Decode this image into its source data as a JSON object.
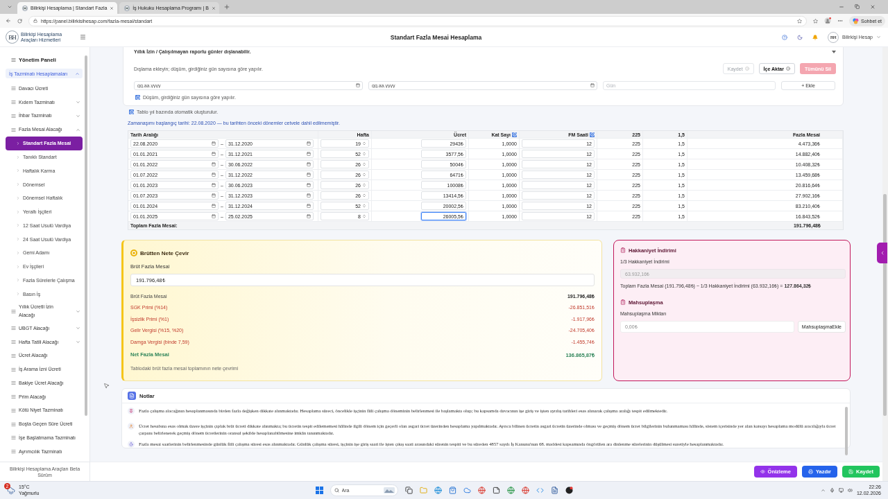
{
  "browser": {
    "tabs": [
      {
        "title": "Bilirkişi Hesaplama | Standart Fazla",
        "selected": true
      },
      {
        "title": "İş Hukuku Hesaplama Programı | B",
        "selected": false
      }
    ],
    "url": "https://panel.bilirkisihesap.com/fazla-mesai/standart",
    "chat_button": "Sohbet et"
  },
  "header": {
    "logo_initials": "BH",
    "logo_text": "Bilirkişi Hesaplama Araçları Hizmetleri",
    "title": "Standart Fazla Mesai Hesaplama",
    "account_initials": "BH",
    "account": "Bilirkişi Hesap"
  },
  "sidebar": {
    "panel_link": "Yönetim Paneli",
    "group": {
      "label": "İş Tazminatı Hesaplamaları",
      "expanded": true,
      "items": [
        {
          "label": "Davacı Ücreti",
          "kind": "link"
        },
        {
          "label": "Kıdem Tazminatı",
          "kind": "menu",
          "expanded": false
        },
        {
          "label": "İhbar Tazminatı",
          "kind": "menu",
          "expanded": false
        },
        {
          "label": "Fazla Mesai Alacağı",
          "kind": "menu",
          "expanded": true,
          "children": [
            {
              "label": "Standart Fazla Mesai",
              "selected": true
            },
            {
              "label": "Tanıklı Standart",
              "selected": false
            },
            {
              "label": "Haftalık Karma",
              "selected": false
            },
            {
              "label": "Dönemsel",
              "selected": false
            },
            {
              "label": "Dönemsel Haftalık",
              "selected": false
            },
            {
              "label": "Yeraltı İşçileri",
              "selected": false
            },
            {
              "label": "12 Saat Usulü Vardiya",
              "selected": false
            },
            {
              "label": "24 Saat Usulü Vardiya",
              "selected": false
            },
            {
              "label": "Gemi Adamı",
              "selected": false
            },
            {
              "label": "Ev İşçileri",
              "selected": false
            },
            {
              "label": "Fazla Sürelerle Çalışma",
              "selected": false
            },
            {
              "label": "Basın İş",
              "selected": false
            }
          ]
        },
        {
          "label": "Yıllık Ücretli İzin Alacağı",
          "kind": "menu",
          "expanded": false
        },
        {
          "label": "UBGT Alacağı",
          "kind": "menu",
          "expanded": false
        },
        {
          "label": "Hafta Tatili Alacağı",
          "kind": "menu",
          "expanded": false
        },
        {
          "label": "Ücret Alacağı",
          "kind": "link"
        },
        {
          "label": "İş Arama İzni Ücreti",
          "kind": "link"
        },
        {
          "label": "Bakiye Ücret Alacağı",
          "kind": "link"
        },
        {
          "label": "Prim Alacağı",
          "kind": "link"
        },
        {
          "label": "Kötü Niyet Tazminatı",
          "kind": "link"
        },
        {
          "label": "Boşta Geçen Süre Ücreti",
          "kind": "link"
        },
        {
          "label": "İşe Başlatmama Tazminatı",
          "kind": "link"
        },
        {
          "label": "Ayrımcılık Tazminatı",
          "kind": "link"
        }
      ]
    },
    "footer": "Bilirkişi Hesaplama Araçları Beta Sürüm"
  },
  "exclusions": {
    "title": "Yıllık İzin / Çalışılmayan raporlu günler dışlanabilir.",
    "hint": "Dışlama ekleyin; düşüm, girdiğiniz gün sayısına göre yapılır.",
    "buttons": [
      {
        "label": "Kaydet",
        "kind": "save",
        "disabled": true
      },
      {
        "label": "İçe Aktar",
        "kind": "import",
        "disabled": false
      },
      {
        "label": "Tümünü Sil",
        "kind": "delete",
        "disabled": true
      }
    ],
    "start_date": {
      "placeholder": "gg.aa.yyyy"
    },
    "end_date": {
      "placeholder": "gg.aa.yyyy"
    },
    "days": {
      "placeholder": "Gün"
    },
    "add_button": "+ Ekle",
    "note": "Düşüm, girdiğiniz gün sayısına göre yapılır."
  },
  "table_note": "Tablo yıl bazında otomatik oluşturulur.",
  "limitation_note": "Zamanaşımı başlangıç tarihi: 22.08.2020 — bu tarihten önceki dönemler cetvele dahil edilmemiştir.",
  "table": {
    "columns": [
      {
        "label": "Tarih Aralığı",
        "info": false
      },
      {
        "label": "Hafta",
        "info": false
      },
      {
        "label": "Ücret",
        "info": false
      },
      {
        "label": "Kat Sayı",
        "info": true
      },
      {
        "label": "FM Saati",
        "info": true
      },
      {
        "label": "225",
        "info": false
      },
      {
        "label": "1,5",
        "info": false
      },
      {
        "label": "Fazla Mesai",
        "info": false
      }
    ],
    "rows": [
      {
        "start": "22.08.2020",
        "sep": "–",
        "end": "31.12.2020",
        "weeks": "19",
        "wage": "2943₺",
        "focused": false,
        "coefficient": "1,0000",
        "hours": "12",
        "divisor": "225",
        "multiplier": "1,5",
        "overtime": "4.473,36₺"
      },
      {
        "start": "01.01.2021",
        "sep": "–",
        "end": "31.12.2021",
        "weeks": "52",
        "wage": "3577,5₺",
        "focused": false,
        "coefficient": "1,0000",
        "hours": "12",
        "divisor": "225",
        "multiplier": "1,5",
        "overtime": "14.882,40₺"
      },
      {
        "start": "01.01.2022",
        "sep": "–",
        "end": "30.06.2022",
        "weeks": "26",
        "wage": "5004₺",
        "focused": false,
        "coefficient": "1,0000",
        "hours": "12",
        "divisor": "225",
        "multiplier": "1,5",
        "overtime": "10.408,32₺"
      },
      {
        "start": "01.07.2022",
        "sep": "–",
        "end": "31.12.2022",
        "weeks": "26",
        "wage": "6471₺",
        "focused": false,
        "coefficient": "1,0000",
        "hours": "12",
        "divisor": "225",
        "multiplier": "1,5",
        "overtime": "13.459,68₺"
      },
      {
        "start": "01.01.2023",
        "sep": "–",
        "end": "30.06.2023",
        "weeks": "26",
        "wage": "10008₺",
        "focused": false,
        "coefficient": "1,0000",
        "hours": "12",
        "divisor": "225",
        "multiplier": "1,5",
        "overtime": "20.816,64₺"
      },
      {
        "start": "01.07.2023",
        "sep": "–",
        "end": "31.12.2023",
        "weeks": "26",
        "wage": "13414,5₺",
        "focused": false,
        "coefficient": "1,0000",
        "hours": "12",
        "divisor": "225",
        "multiplier": "1,5",
        "overtime": "27.902,16₺"
      },
      {
        "start": "01.01.2024",
        "sep": "–",
        "end": "31.12.2024",
        "weeks": "52",
        "wage": "20002,5₺",
        "focused": false,
        "coefficient": "1,0000",
        "hours": "12",
        "divisor": "225",
        "multiplier": "1,5",
        "overtime": "83.210,40₺"
      },
      {
        "start": "01.01.2025",
        "sep": "–",
        "end": "25.02.2025",
        "weeks": "8",
        "wage": "26005,5₺",
        "focused": true,
        "coefficient": "1,0000",
        "hours": "12",
        "divisor": "225",
        "multiplier": "1,5",
        "overtime": "16.843,52₺"
      }
    ],
    "total_label": "Toplam Fazla Mesai:",
    "total": "191.796,48₺"
  },
  "net_card": {
    "title": "Brütten Nete Çevir",
    "field_label": "Brüt Fazla Mesai",
    "field_value": "191.796,48₺",
    "lines": [
      {
        "label": "Brüt Fazla Mesai",
        "amount": "191.796,48₺",
        "kind": "gross"
      },
      {
        "label": "SGK Primi (%14)",
        "amount": "-26.851,51₺",
        "kind": "deduction"
      },
      {
        "label": "İşsizlik Primi (%1)",
        "amount": "-1.917,96₺",
        "kind": "deduction"
      },
      {
        "label": "Gelir Vergisi (%15, %20)",
        "amount": "-24.705,40₺",
        "kind": "deduction"
      },
      {
        "label": "Damga Vergisi (binde 7,59)",
        "amount": "-1.455,74₺",
        "kind": "deduction"
      },
      {
        "label": "Net Fazla Mesai",
        "amount": "136.865,87₺",
        "kind": "net"
      }
    ],
    "footnote": "Tablodaki brüt fazla mesai toplamının nete çevrimi"
  },
  "fairness_card": {
    "title": "Hakkaniyet İndirimi",
    "reduction": {
      "label": "1/3 Hakkaniyet İndirimi",
      "value": "63.932,16₺",
      "disabled": true
    },
    "formula": "Toplam Fazla Mesai (191.796,48₺) − 1/3 Hakkaniyet İndirimi (63.932,16₺) = **127.864,32₺**",
    "offset": {
      "title": "Mahsuplaşma",
      "label": "Mahsuplaşma Miktarı",
      "placeholder": "0,00₺",
      "button": "MahsuplaşmaEkle"
    }
  },
  "notes": {
    "title": "Notlar",
    "items": [
      "Fazla çalışma alacağının hesaplanmasında birden fazla değişken dikkate alınmaktadır. Hesaplama süreci, öncelikle işçinin fiili çalışma döneminin belirlenmesi ile başlamakta olup; bu kapsamda davacının işe giriş ve işten ayrılış tarihleri esas alınarak çalışma aralığı tespit edilmektedir.",
      "Ücret hesabına esas olmak üzere işçinin çıplak brüt ücreti dikkate alınmakta; bu ücretin tespit edilememesi hâlinde ilgili dönem için geçerli olan asgari ücret üzerinden hesaplama yapılmaktadır. Ayrıca bilinen ücretin asgari ücretin üzerinde olması ve geçmiş dönem ücret bilgilerinin bulunmaması hâlinde, sistem içerisinde yer alan katsayı hesaplama modülü aracılığıyla ücret çarpanı belirlenerek geçmiş dönem ücretlerinin oransal şekilde hesaplanabilmesine imkân tanınmaktadır.",
      "Fazla mesai saatlerinin belirlenmesinde günlük fiili çalışma süresi esas alınmaktadır. Günlük çalışma süresi, işçinin işe giriş saati ile işten çıkış saati arasındaki sürenin tespiti ve bu süreden 4857 sayılı İş Kanunu'nun 68. maddesi kapsamında öngörülen ara dinlenme sürelerinin düşülmesi suretiyle hesaplanmaktadır."
    ]
  },
  "actions": [
    {
      "label": "Önizleme",
      "kind": "preview"
    },
    {
      "label": "Yazdır",
      "kind": "print"
    },
    {
      "label": "Kaydet",
      "kind": "save"
    }
  ],
  "taskbar": {
    "weather_badge": "2",
    "temperature": "15°C",
    "weather": "Yağmurlu",
    "search_placeholder": "Ara",
    "time": "22:26",
    "date": "12.02.2026"
  }
}
